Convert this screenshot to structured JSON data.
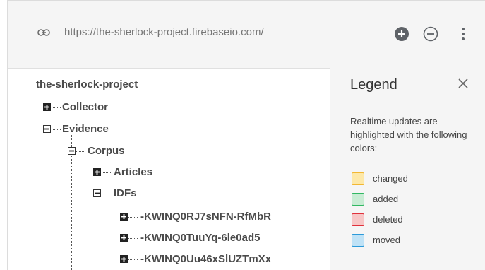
{
  "url_bar": {
    "url": "https://the-sherlock-project.firebaseio.com/",
    "link_icon": "link-icon",
    "add_icon": "add-circle-icon",
    "remove_icon": "remove-circle-icon",
    "more_icon": "more-vert-icon"
  },
  "tree": {
    "root": "the-sherlock-project",
    "nodes": {
      "collector": "Collector",
      "evidence": "Evidence",
      "corpus": "Corpus",
      "articles": "Articles",
      "idfs": "IDFs",
      "idf_1": "-KWINQ0RJ7sNFN-RfMbR",
      "idf_2": "-KWINQ0TuuYq-6le0ad5",
      "idf_3": "-KWINQ0Uu46xSlUZTmXx"
    }
  },
  "legend": {
    "title": "Legend",
    "description": "Realtime updates are highlighted with the following colors:",
    "items": [
      {
        "label": "changed",
        "fill": "#fde8a8",
        "border": "#f2b733"
      },
      {
        "label": "added",
        "fill": "#c8ecd4",
        "border": "#32b863"
      },
      {
        "label": "deleted",
        "fill": "#f7c6c6",
        "border": "#e0313c"
      },
      {
        "label": "moved",
        "fill": "#bfe2f6",
        "border": "#2c9ad9"
      }
    ]
  }
}
